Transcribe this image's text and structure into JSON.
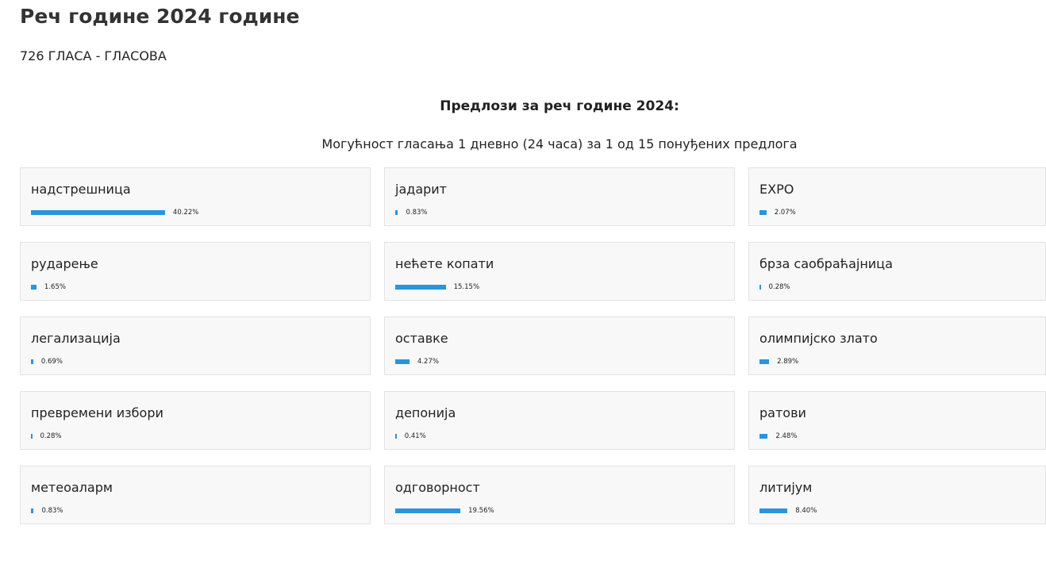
{
  "header": {
    "title": "Реч године 2024 године",
    "votes": "726 ГЛАСА - ГЛАСОВА"
  },
  "poll": {
    "heading": "Предлози за реч године 2024:",
    "note": "Могућност гласања 1 дневно (24 часа) за 1 од 15 понуђених предлога"
  },
  "colors": {
    "bar": "#2a94dd",
    "card_background": "#f8f8f8",
    "card_border": "#e3e3e3"
  },
  "options": [
    {
      "label": "надстрешница",
      "percent": 40.22,
      "percent_text": "40.22%"
    },
    {
      "label": "јадарит",
      "percent": 0.83,
      "percent_text": "0.83%"
    },
    {
      "label": "EXPO",
      "percent": 2.07,
      "percent_text": "2.07%"
    },
    {
      "label": "рударење",
      "percent": 1.65,
      "percent_text": "1.65%"
    },
    {
      "label": "нећете копати",
      "percent": 15.15,
      "percent_text": "15.15%"
    },
    {
      "label": "брза саобраћајница",
      "percent": 0.28,
      "percent_text": "0.28%"
    },
    {
      "label": "легализација",
      "percent": 0.69,
      "percent_text": "0.69%"
    },
    {
      "label": "оставке",
      "percent": 4.27,
      "percent_text": "4.27%"
    },
    {
      "label": "олимпијско злато",
      "percent": 2.89,
      "percent_text": "2.89%"
    },
    {
      "label": "превремени избори",
      "percent": 0.28,
      "percent_text": "0.28%"
    },
    {
      "label": "депонија",
      "percent": 0.41,
      "percent_text": "0.41%"
    },
    {
      "label": "ратови",
      "percent": 2.48,
      "percent_text": "2.48%"
    },
    {
      "label": "метеоаларм",
      "percent": 0.83,
      "percent_text": "0.83%"
    },
    {
      "label": "одговорност",
      "percent": 19.56,
      "percent_text": "19.56%"
    },
    {
      "label": "литијум",
      "percent": 8.4,
      "percent_text": "8.40%"
    }
  ]
}
